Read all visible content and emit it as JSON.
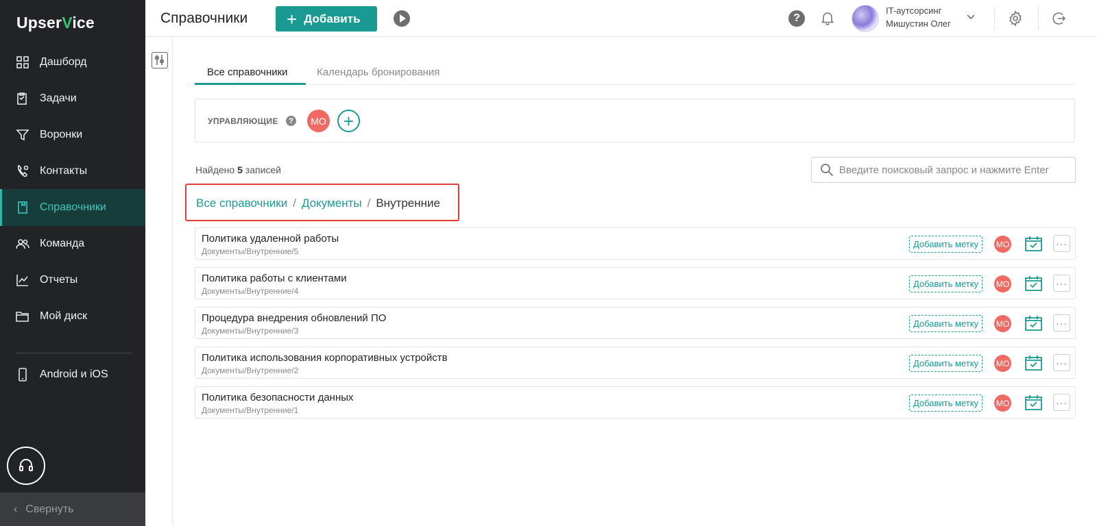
{
  "brand": {
    "logo_pre": "Upser",
    "logo_v": "V",
    "logo_post": "ice"
  },
  "sidebar": {
    "items": [
      {
        "label": "Дашборд",
        "icon": "dashboard-icon"
      },
      {
        "label": "Задачи",
        "icon": "tasks-icon"
      },
      {
        "label": "Воронки",
        "icon": "funnel-icon"
      },
      {
        "label": "Контакты",
        "icon": "contacts-icon"
      },
      {
        "label": "Справочники",
        "icon": "directory-icon",
        "active": true
      },
      {
        "label": "Команда",
        "icon": "team-icon"
      },
      {
        "label": "Отчеты",
        "icon": "reports-icon"
      },
      {
        "label": "Мой диск",
        "icon": "folder-icon"
      },
      {
        "label": "Android и iOS",
        "icon": "mobile-icon"
      }
    ],
    "collapse_label": "Свернуть"
  },
  "header": {
    "title": "Справочники",
    "add_label": "Добавить",
    "help_glyph": "?",
    "user_org": "IT-аутсорсинг",
    "user_name": "Мишустин Олег"
  },
  "tabs": [
    {
      "label": "Все справочники",
      "active": true
    },
    {
      "label": "Календарь бронирования",
      "active": false
    }
  ],
  "managers": {
    "label": "УПРАВЛЯЮЩИЕ",
    "help_glyph": "?",
    "avatar_initials": "МО",
    "add_glyph": "+"
  },
  "results": {
    "prefix": "Найдено",
    "count": "5",
    "suffix": "записей"
  },
  "search": {
    "placeholder": "Введите поисковый запрос и нажмите Enter"
  },
  "breadcrumb": {
    "items": [
      "Все справочники",
      "Документы"
    ],
    "current": "Внутренние",
    "separator": "/"
  },
  "records": [
    {
      "title": "Политика удаленной работы",
      "path": "Документы/Внутренние/5",
      "tag_label": "Добавить метку",
      "avatar": "МО"
    },
    {
      "title": "Политика работы с клиентами",
      "path": "Документы/Внутренние/4",
      "tag_label": "Добавить метку",
      "avatar": "МО"
    },
    {
      "title": "Процедура внедрения обновлений ПО",
      "path": "Документы/Внутренние/3",
      "tag_label": "Добавить метку",
      "avatar": "МО"
    },
    {
      "title": "Политика использования корпоративных устройств",
      "path": "Документы/Внутренние/2",
      "tag_label": "Добавить метку",
      "avatar": "МО"
    },
    {
      "title": "Политика безопасности данных",
      "path": "Документы/Внутренние/1",
      "tag_label": "Добавить метку",
      "avatar": "МО"
    }
  ],
  "colors": {
    "accent": "#1b9a94",
    "sidebar_bg": "#222326",
    "avatar_red": "#f06a64",
    "highlight_border": "#e53935"
  }
}
